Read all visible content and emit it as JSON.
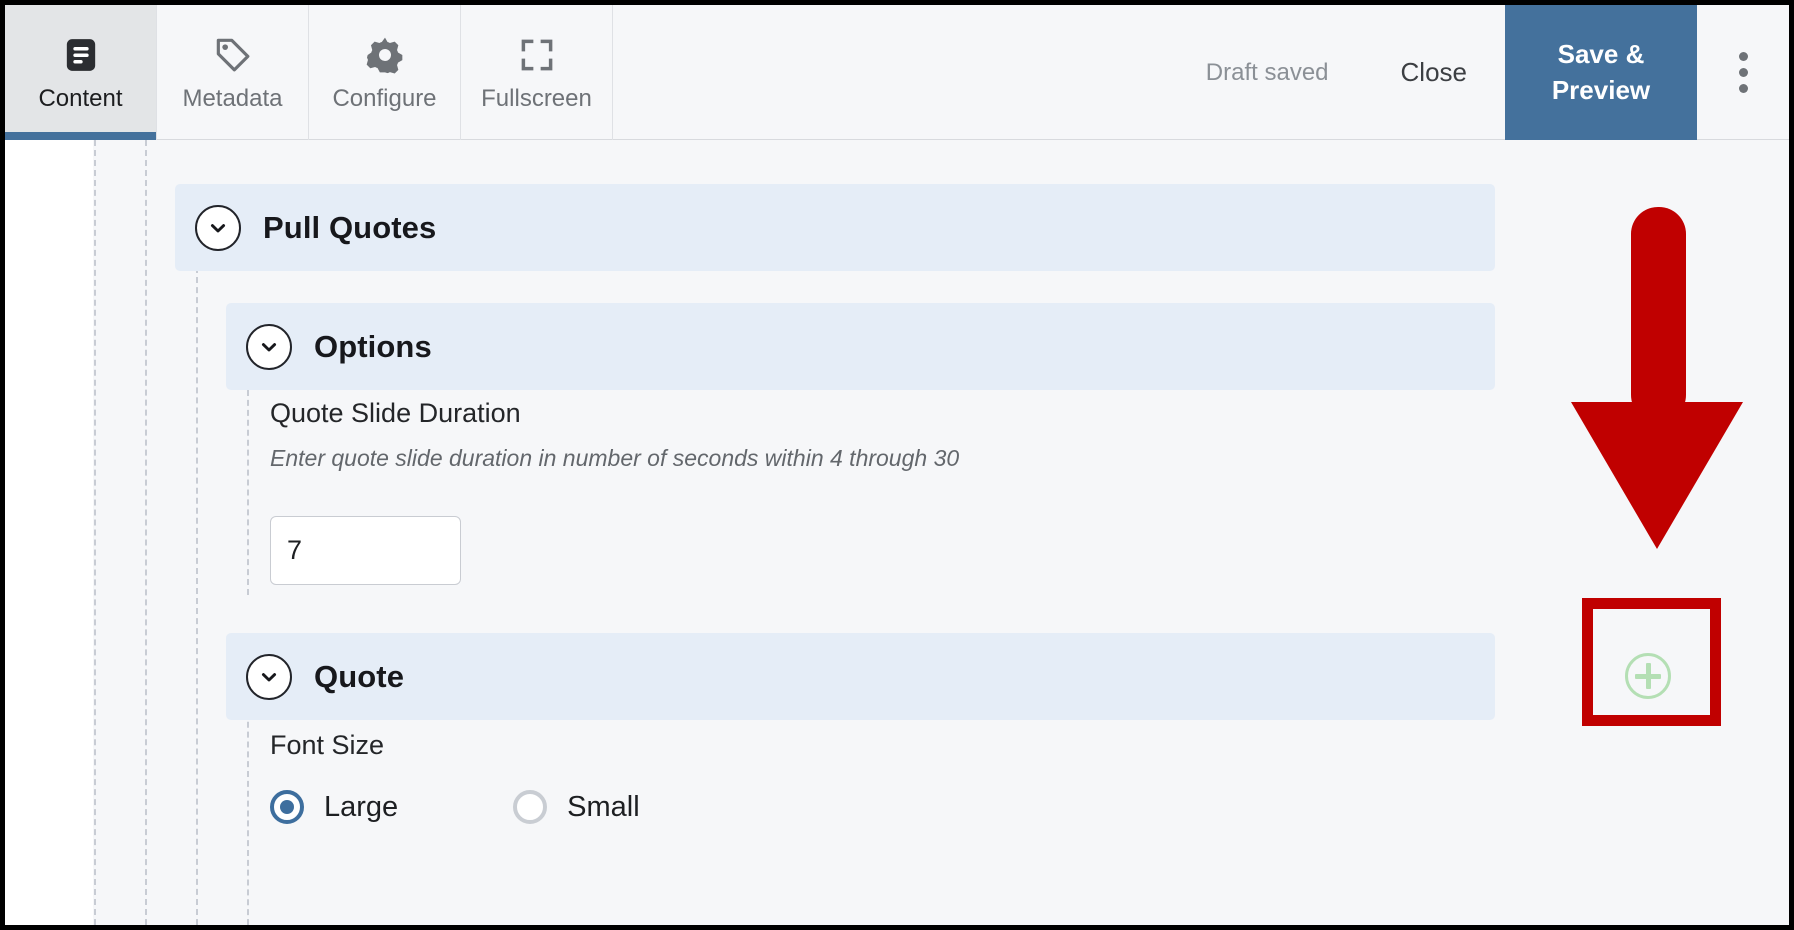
{
  "toolbar": {
    "tabs": [
      {
        "label": "Content",
        "icon": "document-icon",
        "active": true
      },
      {
        "label": "Metadata",
        "icon": "tag-icon",
        "active": false
      },
      {
        "label": "Configure",
        "icon": "gear-icon",
        "active": false
      },
      {
        "label": "Fullscreen",
        "icon": "fullscreen-icon",
        "active": false
      }
    ],
    "draft_status": "Draft saved",
    "close_label": "Close",
    "save_preview_label_line1": "Save &",
    "save_preview_label_line2": "Preview",
    "overflow_menu_icon": "kebab-menu-icon"
  },
  "sections": {
    "pull_quotes": {
      "title": "Pull Quotes",
      "chevron_icon": "chevron-down-icon"
    },
    "options": {
      "title": "Options",
      "chevron_icon": "chevron-down-icon"
    },
    "quote": {
      "title": "Quote",
      "chevron_icon": "chevron-down-icon",
      "add_icon": "plus-circle-icon"
    }
  },
  "fields": {
    "quote_slide_duration": {
      "label": "Quote Slide Duration",
      "help": "Enter quote slide duration in number of seconds within 4 through 30",
      "value": "7",
      "placeholder": ""
    },
    "font_size": {
      "label": "Font Size",
      "options": [
        {
          "label": "Large",
          "selected": true
        },
        {
          "label": "Small",
          "selected": false
        }
      ]
    }
  },
  "annotations": {
    "arrow_color": "#c00000",
    "highlight_box_color": "#c00000",
    "arrow_icon": "down-arrow-annotation",
    "highlight_icon": "highlight-box-annotation"
  },
  "colors": {
    "accent_blue": "#44719c",
    "section_header_bg": "#e5edf7",
    "canvas_bg": "#f6f7f9",
    "add_button_green": "#b4dfb4",
    "radio_selected": "#3d6e9e"
  }
}
